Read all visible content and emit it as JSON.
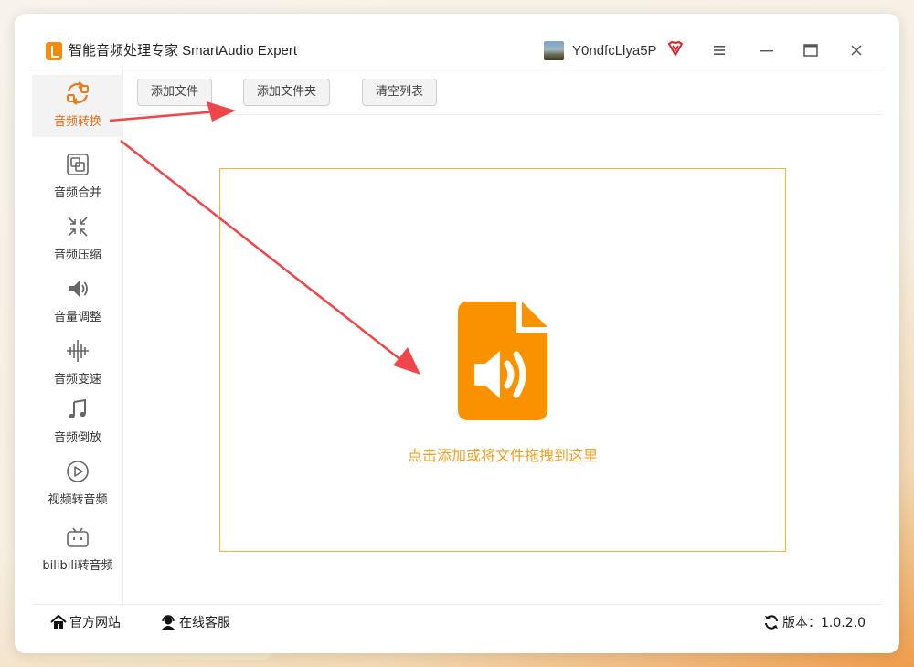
{
  "app": {
    "title": "智能音频处理专家 SmartAudio Expert",
    "username": "Y0ndfcLlya5P",
    "accent_color": "#f28a10"
  },
  "window_controls": [
    "menu-icon",
    "minimize-icon",
    "maximize-icon",
    "close-icon"
  ],
  "sidebar": {
    "items": [
      {
        "label": "音频转换",
        "icon": "convert-icon",
        "active": true
      },
      {
        "label": "音频合并",
        "icon": "merge-icon",
        "active": false
      },
      {
        "label": "音频压缩",
        "icon": "compress-icon",
        "active": false
      },
      {
        "label": "音量调整",
        "icon": "volume-icon",
        "active": false
      },
      {
        "label": "音频变速",
        "icon": "speed-icon",
        "active": false
      },
      {
        "label": "音频倒放",
        "icon": "music-note-icon",
        "active": false
      },
      {
        "label": "视频转音频",
        "icon": "play-icon",
        "active": false
      },
      {
        "label": "bilibili转音频",
        "icon": "bilibili-icon",
        "active": false
      }
    ]
  },
  "toolbar": {
    "add_file": "添加文件",
    "add_folder": "添加文件夹",
    "clear_list": "清空列表"
  },
  "dropzone": {
    "text": "点击添加或将文件拖拽到这里",
    "icon": "audio-file-icon",
    "border_color": "#f0b43a"
  },
  "footer": {
    "website": "官方网站",
    "support": "在线客服",
    "version": "版本：1.0.2.0"
  }
}
